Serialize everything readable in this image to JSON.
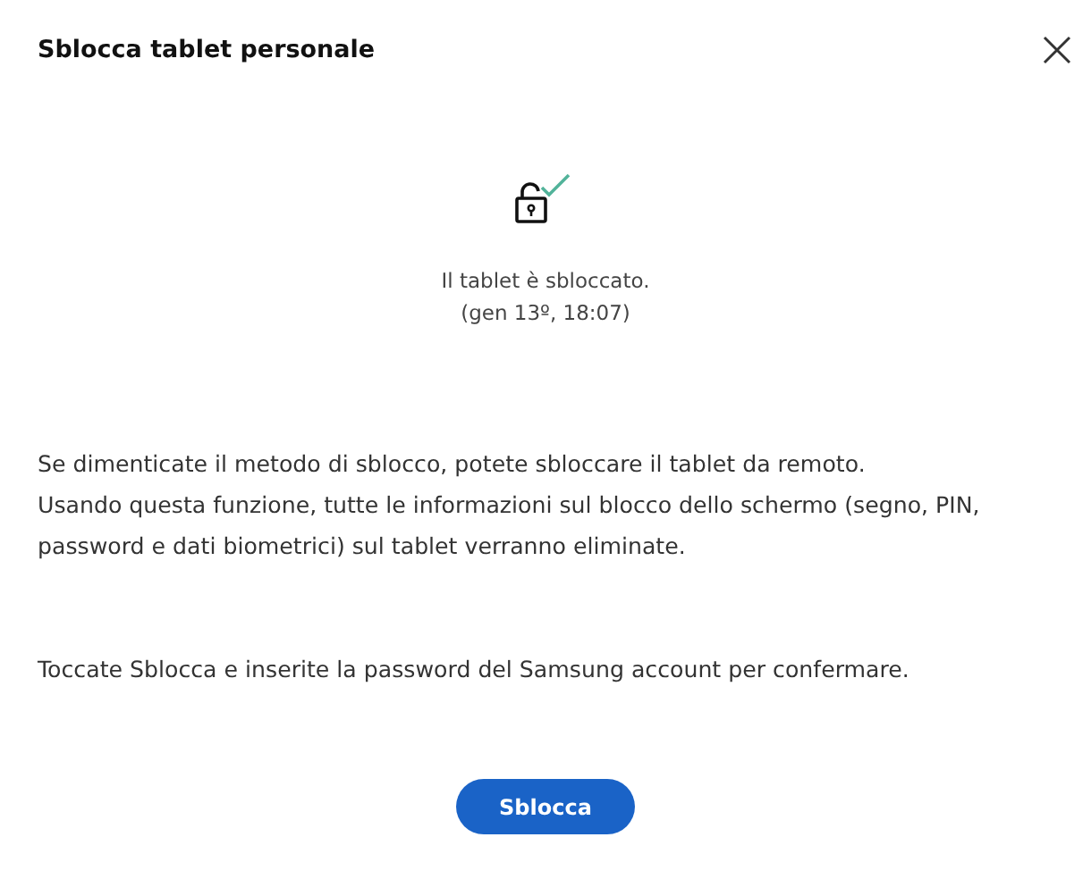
{
  "dialog": {
    "title": "Sblocca tablet personale"
  },
  "status": {
    "unlocked": true,
    "lines": [
      "Il tablet è sbloccato.",
      "(gen 13º, 18:07)"
    ]
  },
  "description": [
    "Se dimenticate il metodo di sblocco, potete sbloccare il tablet da remoto.",
    "Usando questa funzione, tutte le informazioni sul blocco dello schermo (segno, PIN, password e dati biometrici) sul tablet verranno eliminate."
  ],
  "instruction": "Toccate Sblocca e inserite la password del Samsung account per confermare.",
  "button": {
    "label": "Sblocca"
  }
}
